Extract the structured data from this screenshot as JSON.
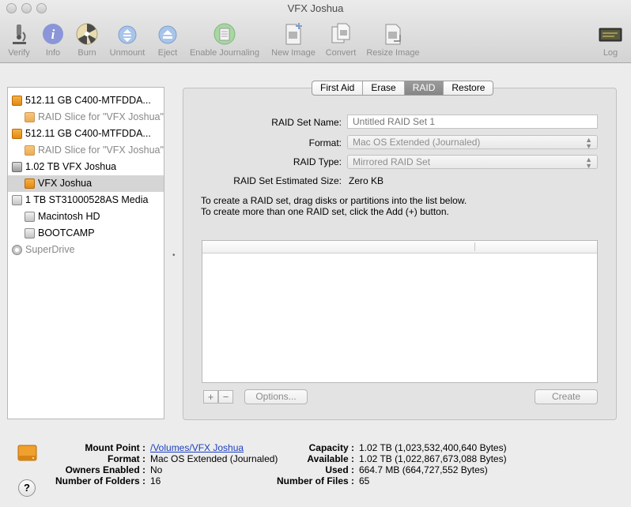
{
  "window": {
    "title": "VFX Joshua"
  },
  "toolbar": {
    "items": [
      {
        "label": "Verify",
        "icon": "microscope-icon"
      },
      {
        "label": "Info",
        "icon": "info-icon"
      },
      {
        "label": "Burn",
        "icon": "burn-icon"
      },
      {
        "label": "Unmount",
        "icon": "unmount-icon"
      },
      {
        "label": "Eject",
        "icon": "eject-icon"
      },
      {
        "label": "Enable Journaling",
        "icon": "journal-icon"
      },
      {
        "label": "New Image",
        "icon": "new-image-icon"
      },
      {
        "label": "Convert",
        "icon": "convert-icon"
      },
      {
        "label": "Resize Image",
        "icon": "resize-image-icon"
      },
      {
        "label": "Log",
        "icon": "log-icon"
      }
    ]
  },
  "sidebar": {
    "items": [
      {
        "label": "512.11 GB C400-MTFDDA...",
        "level": 0,
        "icon": "disk-orange-icon",
        "dim": false,
        "selected": false
      },
      {
        "label": "RAID Slice for \"VFX Joshua\"",
        "level": 1,
        "icon": "volume-orange-icon",
        "dim": true,
        "selected": false
      },
      {
        "label": "512.11 GB C400-MTFDDA...",
        "level": 0,
        "icon": "disk-orange-icon",
        "dim": false,
        "selected": false
      },
      {
        "label": "RAID Slice for \"VFX Joshua\"",
        "level": 1,
        "icon": "volume-orange-icon",
        "dim": true,
        "selected": false
      },
      {
        "label": "1.02 TB VFX Joshua",
        "level": 0,
        "icon": "raid-disk-icon",
        "dim": false,
        "selected": false
      },
      {
        "label": "VFX Joshua",
        "level": 1,
        "icon": "volume-orange-icon",
        "dim": false,
        "selected": true
      },
      {
        "label": "1 TB ST31000528AS Media",
        "level": 0,
        "icon": "disk-gray-icon",
        "dim": false,
        "selected": false
      },
      {
        "label": "Macintosh HD",
        "level": 1,
        "icon": "volume-gray-icon",
        "dim": false,
        "selected": false
      },
      {
        "label": "BOOTCAMP",
        "level": 1,
        "icon": "volume-gray-icon",
        "dim": false,
        "selected": false
      },
      {
        "label": "SuperDrive",
        "level": 0,
        "icon": "optical-drive-icon",
        "dim": true,
        "selected": false
      }
    ]
  },
  "tabs": [
    {
      "label": "First Aid",
      "active": false
    },
    {
      "label": "Erase",
      "active": false
    },
    {
      "label": "RAID",
      "active": true
    },
    {
      "label": "Restore",
      "active": false
    }
  ],
  "raid": {
    "set_name_label": "RAID Set Name:",
    "set_name_placeholder": "Untitled RAID Set 1",
    "format_label": "Format:",
    "format_value": "Mac OS Extended (Journaled)",
    "type_label": "RAID Type:",
    "type_value": "Mirrored RAID Set",
    "size_label": "RAID Set Estimated Size:",
    "size_value": "Zero KB",
    "instruction_1": "To create a RAID set, drag disks or partitions into the list below.",
    "instruction_2": "To create more than one RAID set, click the Add (+) button.",
    "add_label": "+",
    "remove_label": "−",
    "options_label": "Options...",
    "create_label": "Create"
  },
  "footer": {
    "mount_point_label": "Mount Point :",
    "mount_point_value": "/Volumes/VFX Joshua",
    "format_label": "Format :",
    "format_value": "Mac OS Extended (Journaled)",
    "owners_label": "Owners Enabled :",
    "owners_value": "No",
    "folders_label": "Number of Folders :",
    "folders_value": "16",
    "capacity_label": "Capacity :",
    "capacity_value": "1.02 TB (1,023,532,400,640 Bytes)",
    "available_label": "Available :",
    "available_value": "1.02 TB (1,022,867,673,088 Bytes)",
    "used_label": "Used :",
    "used_value": "664.7 MB (664,727,552 Bytes)",
    "files_label": "Number of Files :",
    "files_value": "65",
    "help_label": "?"
  }
}
